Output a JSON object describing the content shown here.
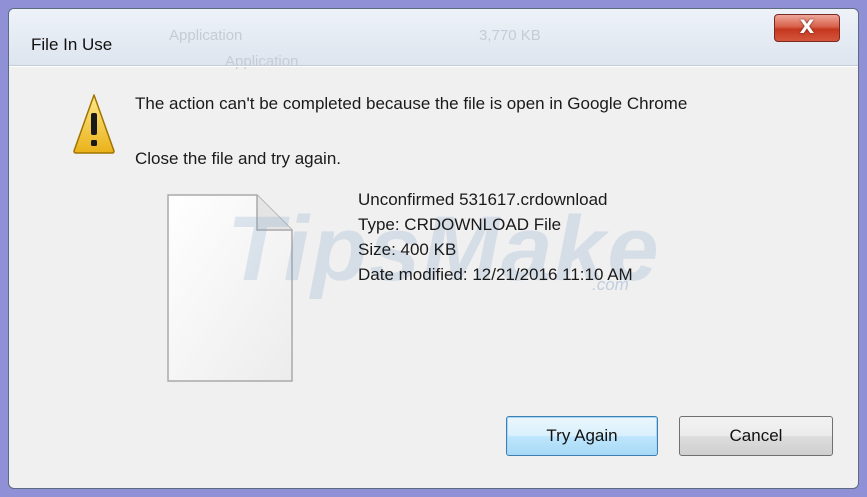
{
  "window": {
    "title": "File In Use",
    "close_label": "X"
  },
  "background_ghost_text": [
    "Application",
    "3,770 KB",
    "Application"
  ],
  "dialog": {
    "message": "The action can't be completed because the file is open in Google Chrome",
    "instruction": "Close the file and try again."
  },
  "file": {
    "name": "Unconfirmed 531617.crdownload",
    "type": "Type: CRDOWNLOAD File",
    "size": "Size: 400 KB",
    "date_modified": "Date modified: 12/21/2016 11:10 AM"
  },
  "buttons": {
    "try_again": "Try Again",
    "cancel": "Cancel"
  },
  "watermark": {
    "text": "TipsMake",
    "suffix": ".com"
  },
  "colors": {
    "desktop": "#8f90d6",
    "window_bg": "#f0f0f0",
    "close_red": "#c5381f",
    "warning_yellow": "#f7d33a",
    "primary_border": "#3c7fb1"
  },
  "icons": {
    "warning": "warning-triangle-icon",
    "file": "blank-file-icon",
    "close": "close-icon"
  }
}
